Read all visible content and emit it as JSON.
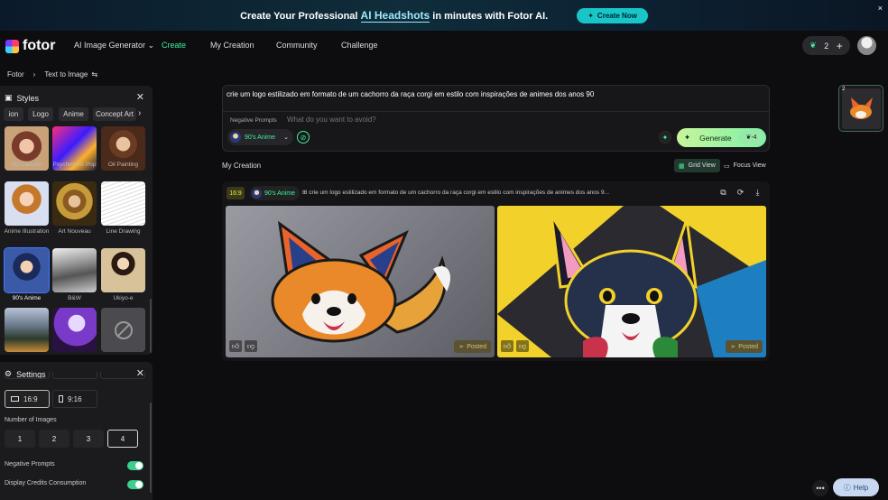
{
  "banner": {
    "text_before": "Create Your Professional ",
    "highlight": "AI Headshots",
    "text_after": " in minutes with Fotor AI.",
    "cta": "Create Now",
    "close": "×"
  },
  "nav": {
    "logo": "fotor",
    "items": [
      "AI Image Generator",
      "Create",
      "My Creation",
      "Community",
      "Challenge"
    ],
    "active": "Create",
    "credits": "2",
    "add": "+"
  },
  "breadcrumb": {
    "home": "Fotor",
    "current": "Text to Image"
  },
  "styles_panel": {
    "title": "Styles",
    "chips": [
      "ion",
      "Logo",
      "Anime",
      "Concept Art"
    ],
    "items": [
      {
        "label": "3D Cartoon"
      },
      {
        "label": "Psychedelic Pop"
      },
      {
        "label": "Oil Painting"
      },
      {
        "label": "Anime Illustration"
      },
      {
        "label": "Art Nouveau"
      },
      {
        "label": "Line Drawing"
      },
      {
        "label": "90's Anime"
      },
      {
        "label": "B&W"
      },
      {
        "label": "Ukiyo-e"
      },
      {
        "label": ""
      },
      {
        "label": ""
      },
      {
        "label": ""
      }
    ],
    "selected": "90's Anime"
  },
  "settings_panel": {
    "title": "Settings",
    "ratios": [
      "16:9",
      "9:16"
    ],
    "selected_ratio": "16:9",
    "num_images_label": "Number of Images",
    "num_options": [
      "1",
      "2",
      "3",
      "4"
    ],
    "selected_num": "4",
    "toggles": [
      {
        "label": "Negative Prompts",
        "on": true
      },
      {
        "label": "Display Credits Consumption",
        "on": true
      }
    ]
  },
  "prompt": {
    "text": "crie um logo estilizado em formato de um cachorro da raça corgi em estilo com inspirações de animes dos anos 90",
    "negative_label": "Negative Prompts",
    "negative_placeholder": "What do you want to avoid?",
    "style": "90's Anime",
    "generate_label": "Generate",
    "generate_cost": "-4"
  },
  "creation": {
    "title": "My Creation",
    "grid_view": "Grid View",
    "focus_view": "Focus View",
    "card": {
      "ratio": "16:9",
      "style": "90's Anime",
      "prompt": "crie um logo estilizado em formato de um cachorro da raça corgi em estilo com inspirações de animes dos anos 9...",
      "posted_label": "Posted"
    }
  },
  "history": {
    "count": "2"
  },
  "help": {
    "label": "Help",
    "more": "•••"
  },
  "colors": {
    "accent": "#3ef0a1",
    "generate_start": "#c7f59c",
    "generate_end": "#7ef0a8",
    "banner_cta": "#18c6c9"
  }
}
